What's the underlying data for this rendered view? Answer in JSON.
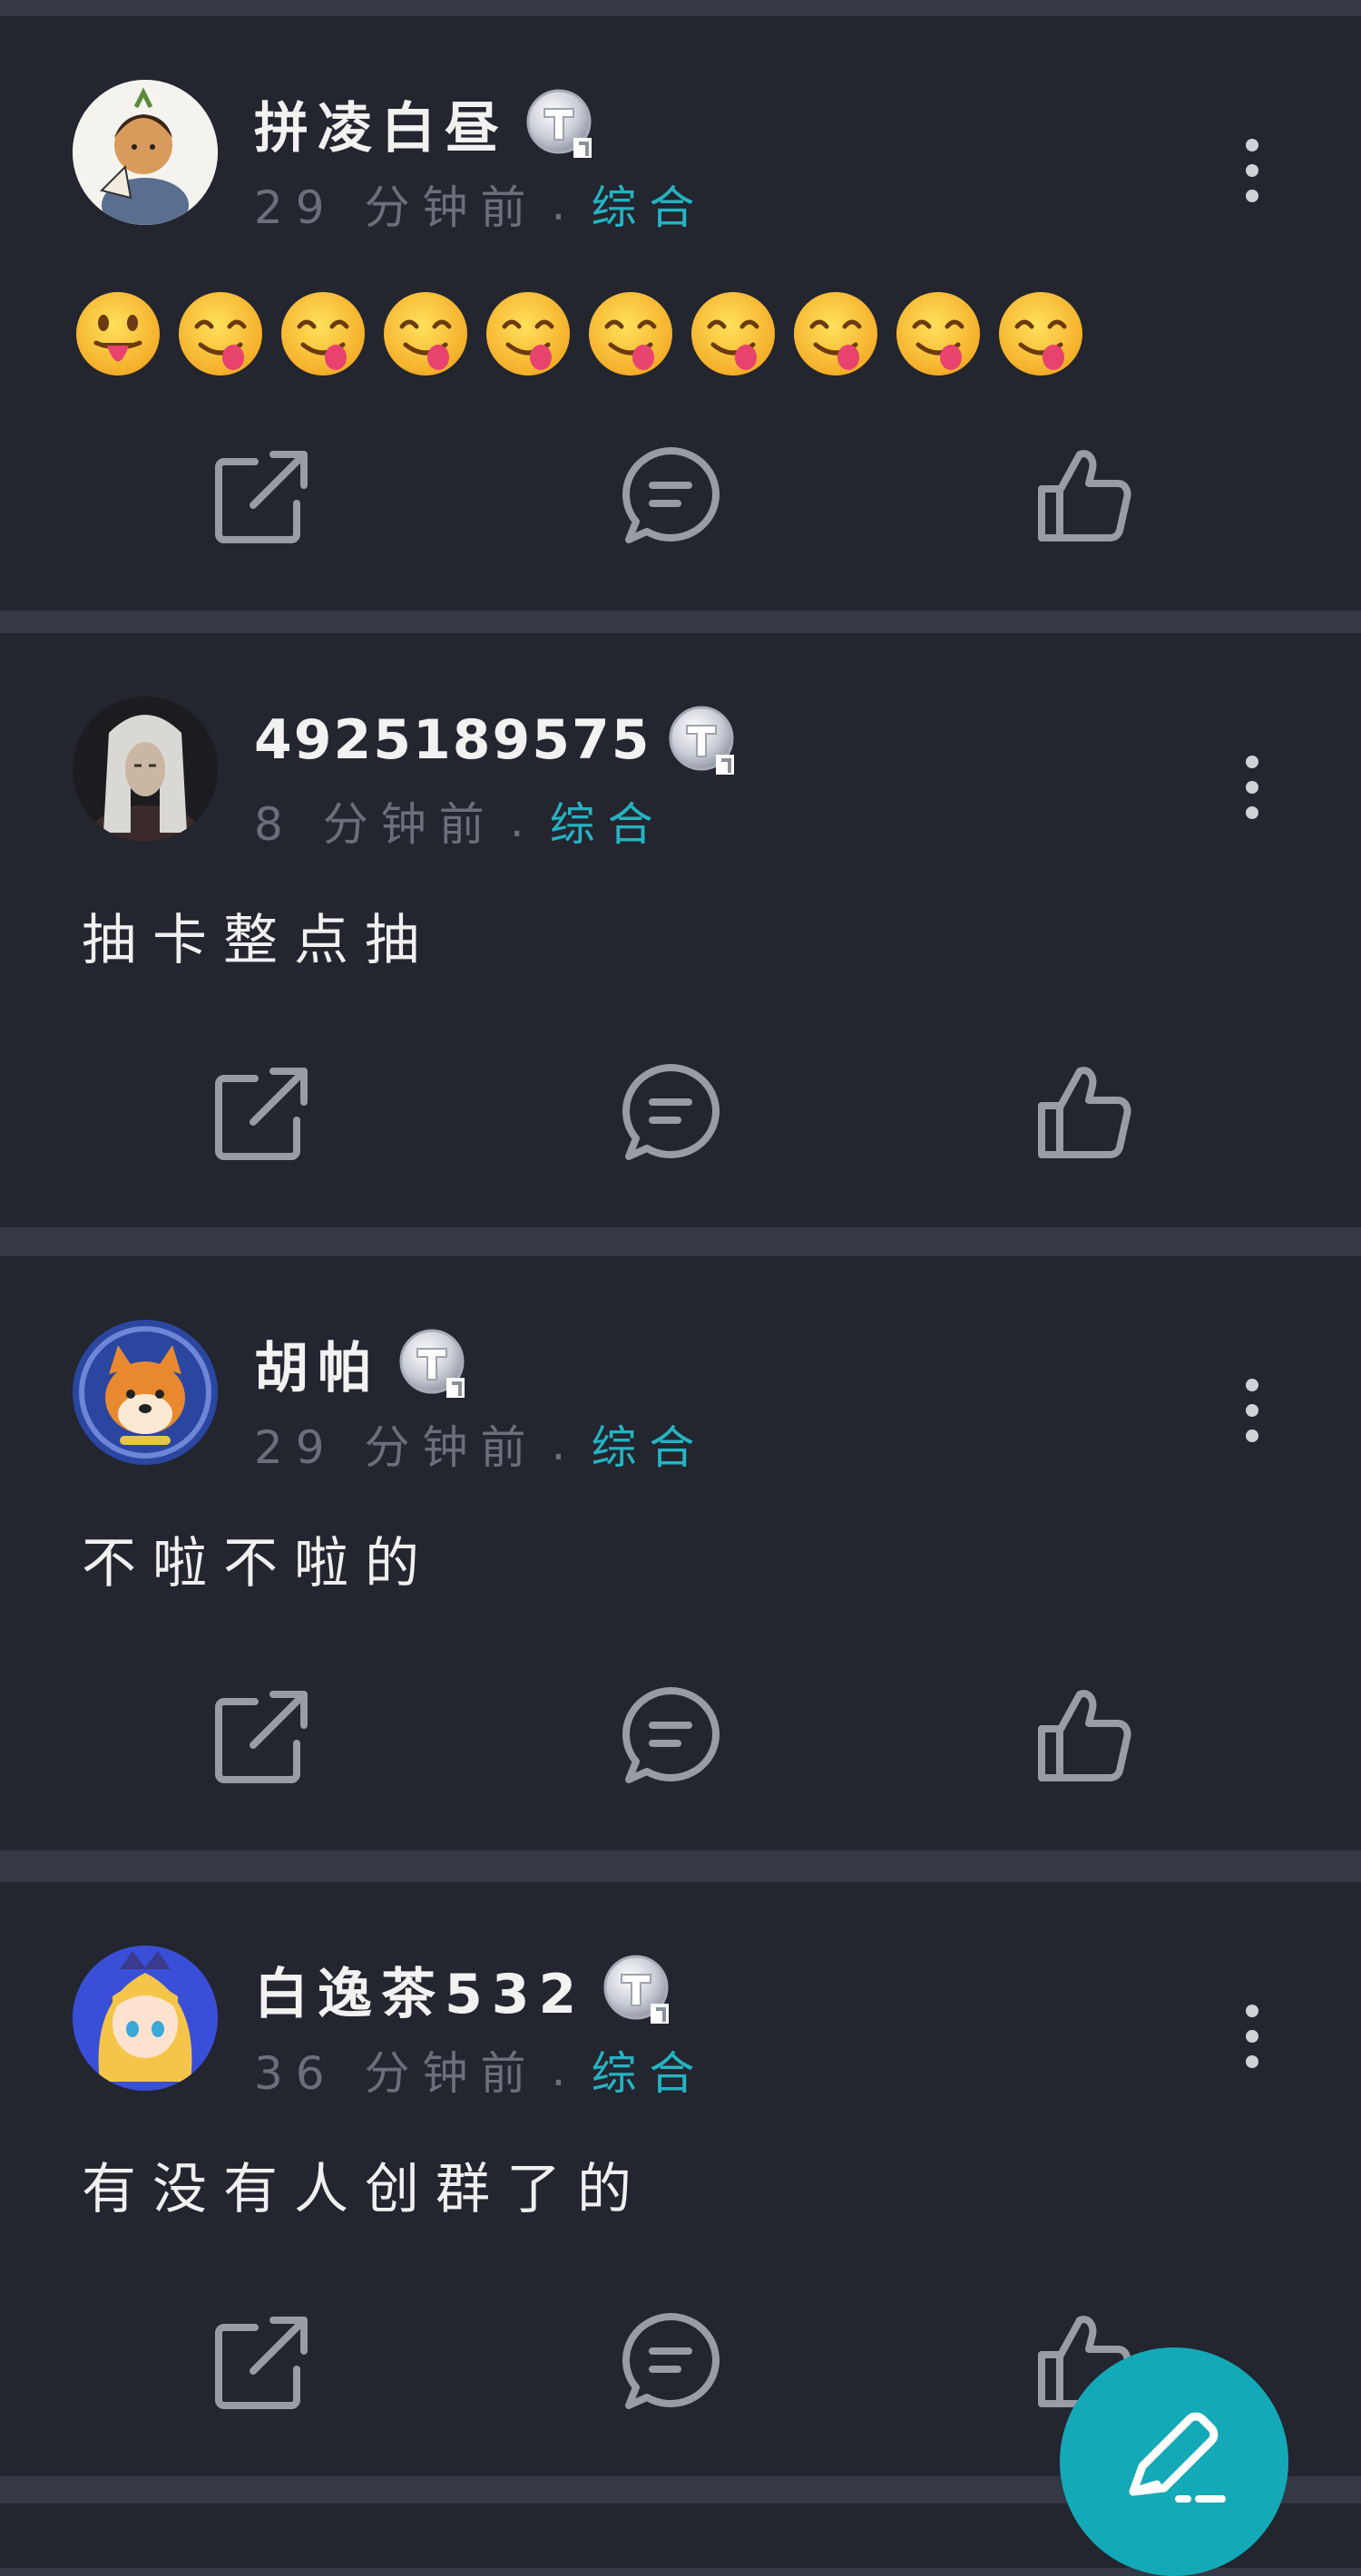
{
  "posts": [
    {
      "username": "拼凌白昼",
      "time_ago": "29 分钟前",
      "category": "综合",
      "content_emojis": [
        "😛",
        "😋",
        "😋",
        "😋",
        "😋",
        "😋",
        "😋",
        "😋",
        "😋",
        "😋"
      ],
      "avatar": "fan-girl-avatar",
      "badge": "silver-T-badge"
    },
    {
      "username": "4925189575",
      "time_ago": "8 分钟前",
      "category": "综合",
      "content": "抽卡整点抽",
      "avatar": "white-haired-character-avatar",
      "badge": "silver-T-badge"
    },
    {
      "username": "胡帕",
      "time_ago": "29 分钟前",
      "category": "综合",
      "content": "不啦不啦的",
      "avatar": "shiba-dog-avatar",
      "badge": "silver-T-badge"
    },
    {
      "username": "白逸茶532",
      "time_ago": "36 分钟前",
      "category": "综合",
      "content": "有没有人创群了的",
      "avatar": "blonde-anime-girl-avatar",
      "badge": "silver-T-badge"
    }
  ],
  "actions": [
    "share-icon",
    "comment-icon",
    "like-icon"
  ],
  "fab": "compose-pencil-icon",
  "colors": {
    "page_bg": "#353845",
    "card_bg": "#23252f",
    "category": "#25b3c2",
    "meta": "#6c6f7b",
    "fab": "#14a9b7"
  }
}
